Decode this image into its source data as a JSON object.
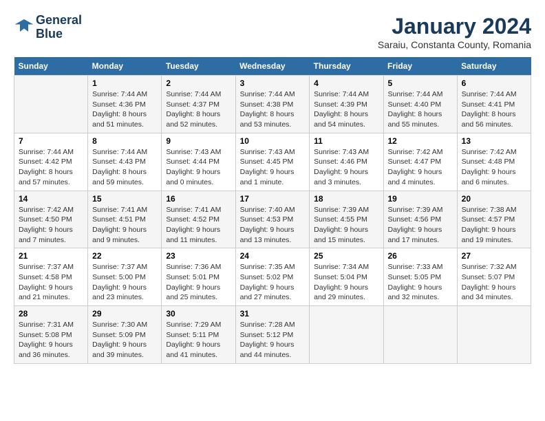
{
  "logo": {
    "line1": "General",
    "line2": "Blue"
  },
  "title": "January 2024",
  "location": "Saraiu, Constanta County, Romania",
  "weekdays": [
    "Sunday",
    "Monday",
    "Tuesday",
    "Wednesday",
    "Thursday",
    "Friday",
    "Saturday"
  ],
  "weeks": [
    [
      {
        "day": "",
        "sunrise": "",
        "sunset": "",
        "daylight": ""
      },
      {
        "day": "1",
        "sunrise": "Sunrise: 7:44 AM",
        "sunset": "Sunset: 4:36 PM",
        "daylight": "Daylight: 8 hours and 51 minutes."
      },
      {
        "day": "2",
        "sunrise": "Sunrise: 7:44 AM",
        "sunset": "Sunset: 4:37 PM",
        "daylight": "Daylight: 8 hours and 52 minutes."
      },
      {
        "day": "3",
        "sunrise": "Sunrise: 7:44 AM",
        "sunset": "Sunset: 4:38 PM",
        "daylight": "Daylight: 8 hours and 53 minutes."
      },
      {
        "day": "4",
        "sunrise": "Sunrise: 7:44 AM",
        "sunset": "Sunset: 4:39 PM",
        "daylight": "Daylight: 8 hours and 54 minutes."
      },
      {
        "day": "5",
        "sunrise": "Sunrise: 7:44 AM",
        "sunset": "Sunset: 4:40 PM",
        "daylight": "Daylight: 8 hours and 55 minutes."
      },
      {
        "day": "6",
        "sunrise": "Sunrise: 7:44 AM",
        "sunset": "Sunset: 4:41 PM",
        "daylight": "Daylight: 8 hours and 56 minutes."
      }
    ],
    [
      {
        "day": "7",
        "sunrise": "Sunrise: 7:44 AM",
        "sunset": "Sunset: 4:42 PM",
        "daylight": "Daylight: 8 hours and 57 minutes."
      },
      {
        "day": "8",
        "sunrise": "Sunrise: 7:44 AM",
        "sunset": "Sunset: 4:43 PM",
        "daylight": "Daylight: 8 hours and 59 minutes."
      },
      {
        "day": "9",
        "sunrise": "Sunrise: 7:43 AM",
        "sunset": "Sunset: 4:44 PM",
        "daylight": "Daylight: 9 hours and 0 minutes."
      },
      {
        "day": "10",
        "sunrise": "Sunrise: 7:43 AM",
        "sunset": "Sunset: 4:45 PM",
        "daylight": "Daylight: 9 hours and 1 minute."
      },
      {
        "day": "11",
        "sunrise": "Sunrise: 7:43 AM",
        "sunset": "Sunset: 4:46 PM",
        "daylight": "Daylight: 9 hours and 3 minutes."
      },
      {
        "day": "12",
        "sunrise": "Sunrise: 7:42 AM",
        "sunset": "Sunset: 4:47 PM",
        "daylight": "Daylight: 9 hours and 4 minutes."
      },
      {
        "day": "13",
        "sunrise": "Sunrise: 7:42 AM",
        "sunset": "Sunset: 4:48 PM",
        "daylight": "Daylight: 9 hours and 6 minutes."
      }
    ],
    [
      {
        "day": "14",
        "sunrise": "Sunrise: 7:42 AM",
        "sunset": "Sunset: 4:50 PM",
        "daylight": "Daylight: 9 hours and 7 minutes."
      },
      {
        "day": "15",
        "sunrise": "Sunrise: 7:41 AM",
        "sunset": "Sunset: 4:51 PM",
        "daylight": "Daylight: 9 hours and 9 minutes."
      },
      {
        "day": "16",
        "sunrise": "Sunrise: 7:41 AM",
        "sunset": "Sunset: 4:52 PM",
        "daylight": "Daylight: 9 hours and 11 minutes."
      },
      {
        "day": "17",
        "sunrise": "Sunrise: 7:40 AM",
        "sunset": "Sunset: 4:53 PM",
        "daylight": "Daylight: 9 hours and 13 minutes."
      },
      {
        "day": "18",
        "sunrise": "Sunrise: 7:39 AM",
        "sunset": "Sunset: 4:55 PM",
        "daylight": "Daylight: 9 hours and 15 minutes."
      },
      {
        "day": "19",
        "sunrise": "Sunrise: 7:39 AM",
        "sunset": "Sunset: 4:56 PM",
        "daylight": "Daylight: 9 hours and 17 minutes."
      },
      {
        "day": "20",
        "sunrise": "Sunrise: 7:38 AM",
        "sunset": "Sunset: 4:57 PM",
        "daylight": "Daylight: 9 hours and 19 minutes."
      }
    ],
    [
      {
        "day": "21",
        "sunrise": "Sunrise: 7:37 AM",
        "sunset": "Sunset: 4:58 PM",
        "daylight": "Daylight: 9 hours and 21 minutes."
      },
      {
        "day": "22",
        "sunrise": "Sunrise: 7:37 AM",
        "sunset": "Sunset: 5:00 PM",
        "daylight": "Daylight: 9 hours and 23 minutes."
      },
      {
        "day": "23",
        "sunrise": "Sunrise: 7:36 AM",
        "sunset": "Sunset: 5:01 PM",
        "daylight": "Daylight: 9 hours and 25 minutes."
      },
      {
        "day": "24",
        "sunrise": "Sunrise: 7:35 AM",
        "sunset": "Sunset: 5:02 PM",
        "daylight": "Daylight: 9 hours and 27 minutes."
      },
      {
        "day": "25",
        "sunrise": "Sunrise: 7:34 AM",
        "sunset": "Sunset: 5:04 PM",
        "daylight": "Daylight: 9 hours and 29 minutes."
      },
      {
        "day": "26",
        "sunrise": "Sunrise: 7:33 AM",
        "sunset": "Sunset: 5:05 PM",
        "daylight": "Daylight: 9 hours and 32 minutes."
      },
      {
        "day": "27",
        "sunrise": "Sunrise: 7:32 AM",
        "sunset": "Sunset: 5:07 PM",
        "daylight": "Daylight: 9 hours and 34 minutes."
      }
    ],
    [
      {
        "day": "28",
        "sunrise": "Sunrise: 7:31 AM",
        "sunset": "Sunset: 5:08 PM",
        "daylight": "Daylight: 9 hours and 36 minutes."
      },
      {
        "day": "29",
        "sunrise": "Sunrise: 7:30 AM",
        "sunset": "Sunset: 5:09 PM",
        "daylight": "Daylight: 9 hours and 39 minutes."
      },
      {
        "day": "30",
        "sunrise": "Sunrise: 7:29 AM",
        "sunset": "Sunset: 5:11 PM",
        "daylight": "Daylight: 9 hours and 41 minutes."
      },
      {
        "day": "31",
        "sunrise": "Sunrise: 7:28 AM",
        "sunset": "Sunset: 5:12 PM",
        "daylight": "Daylight: 9 hours and 44 minutes."
      },
      {
        "day": "",
        "sunrise": "",
        "sunset": "",
        "daylight": ""
      },
      {
        "day": "",
        "sunrise": "",
        "sunset": "",
        "daylight": ""
      },
      {
        "day": "",
        "sunrise": "",
        "sunset": "",
        "daylight": ""
      }
    ]
  ]
}
